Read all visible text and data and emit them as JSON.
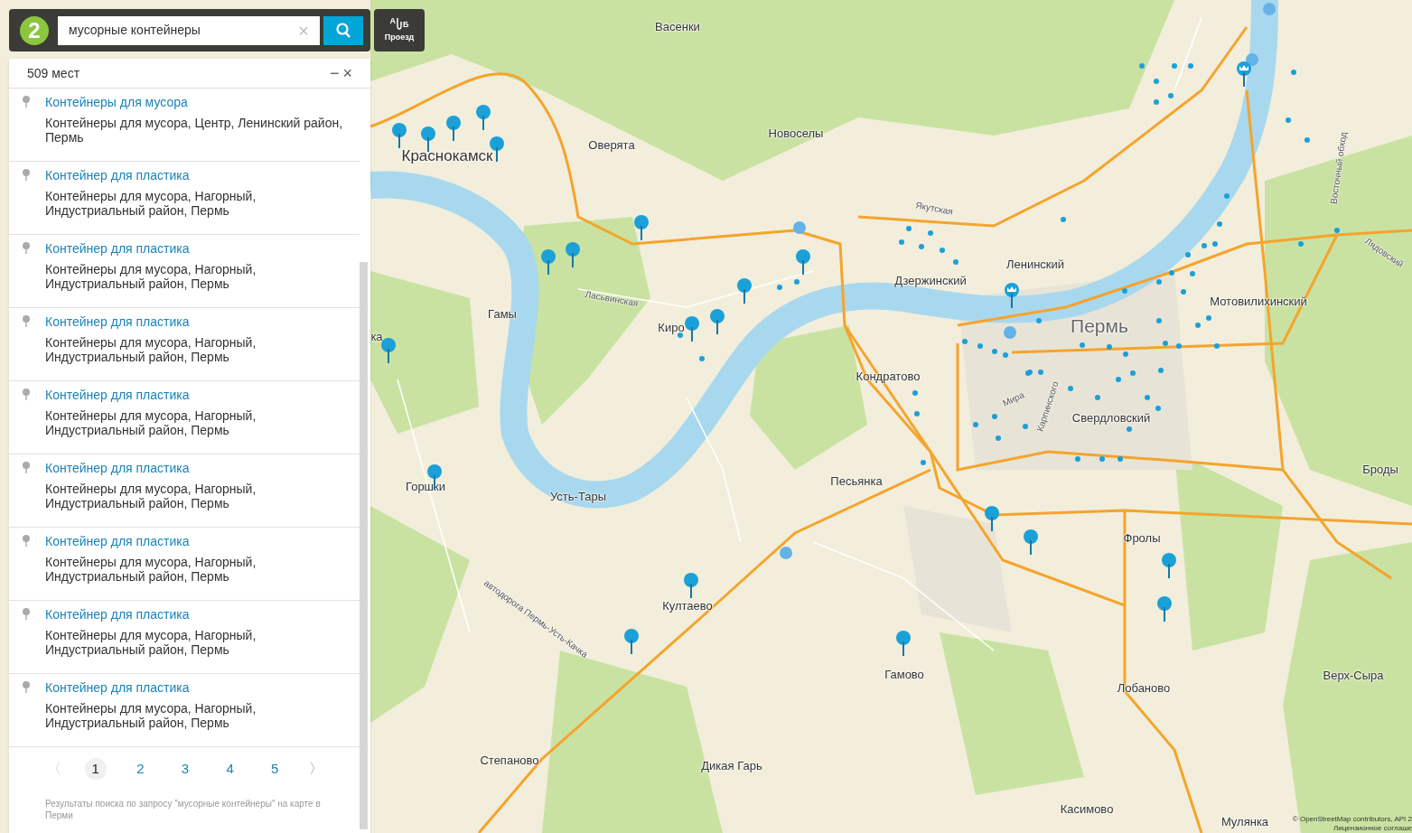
{
  "header": {
    "logo": "2",
    "search": {
      "value": "мусорные контейнеры",
      "clear": "×"
    },
    "route": {
      "from": "А",
      "to": "Б",
      "label": "Проезд"
    }
  },
  "results": {
    "count": "509 мест",
    "minimize": "−",
    "close": "×",
    "items": [
      {
        "title": "Контейнеры для мусора",
        "address": "Контейнеры для мусора, Центр, Ленинский район, Пермь"
      },
      {
        "title": "Контейнер для пластика",
        "address": "Контейнеры для мусора, Нагорный, Индустриальный район, Пермь"
      },
      {
        "title": "Контейнер для пластика",
        "address": "Контейнеры для мусора, Нагорный, Индустриальный район, Пермь"
      },
      {
        "title": "Контейнер для пластика",
        "address": "Контейнеры для мусора, Нагорный, Индустриальный район, Пермь"
      },
      {
        "title": "Контейнер для пластика",
        "address": "Контейнеры для мусора, Нагорный, Индустриальный район, Пермь"
      },
      {
        "title": "Контейнер для пластика",
        "address": "Контейнеры для мусора, Нагорный, Индустриальный район, Пермь"
      },
      {
        "title": "Контейнер для пластика",
        "address": "Контейнеры для мусора, Нагорный, Индустриальный район, Пермь"
      },
      {
        "title": "Контейнер для пластика",
        "address": "Контейнеры для мусора, Нагорный, Индустриальный район, Пермь"
      },
      {
        "title": "Контейнер для пластика",
        "address": "Контейнеры для мусора, Нагорный, Индустриальный район, Пермь"
      }
    ],
    "pagination": {
      "prev": "〈",
      "next": "〉",
      "pages": [
        {
          "label": "1",
          "selected": true
        },
        {
          "label": "2",
          "selected": false
        },
        {
          "label": "3",
          "selected": false
        },
        {
          "label": "4",
          "selected": false
        },
        {
          "label": "5",
          "selected": false
        }
      ]
    },
    "note": "Результаты поиска по запросу \"мусорные контейнеры\" на карте в Перми"
  },
  "map": {
    "labels": [
      {
        "text": "Васенки",
        "kind": "place"
      },
      {
        "text": "Новоселы",
        "kind": "place"
      },
      {
        "text": "Оверята",
        "kind": "place"
      },
      {
        "text": "Краснокамск",
        "kind": "town"
      },
      {
        "text": "Гамы",
        "kind": "place"
      },
      {
        "text": "Якутская",
        "kind": "street"
      },
      {
        "text": "Ленинский",
        "kind": "place"
      },
      {
        "text": "Дзержинский",
        "kind": "place"
      },
      {
        "text": "Пермь",
        "kind": "city"
      },
      {
        "text": "Мотовилихинский",
        "kind": "place"
      },
      {
        "text": "Киро",
        "kind": "place"
      },
      {
        "text": "Ласьвинская",
        "kind": "street"
      },
      {
        "text": "Кондратово",
        "kind": "place"
      },
      {
        "text": "Мира",
        "kind": "street"
      },
      {
        "text": "Карпинского",
        "kind": "street"
      },
      {
        "text": "Свердловский",
        "kind": "place"
      },
      {
        "text": "Песьянка",
        "kind": "place"
      },
      {
        "text": "Усть-Тары",
        "kind": "place"
      },
      {
        "text": "Горшки",
        "kind": "place"
      },
      {
        "text": "Фролы",
        "kind": "place"
      },
      {
        "text": "Броды",
        "kind": "place"
      },
      {
        "text": "Култаево",
        "kind": "place"
      },
      {
        "text": "автодорога Пермь-Усть-Качка",
        "kind": "street"
      },
      {
        "text": "Гамово",
        "kind": "place"
      },
      {
        "text": "Лобаново",
        "kind": "place"
      },
      {
        "text": "Верх-Сыра",
        "kind": "place"
      },
      {
        "text": "Степаново",
        "kind": "place"
      },
      {
        "text": "Дикая Гарь",
        "kind": "place"
      },
      {
        "text": "Касимово",
        "kind": "place"
      },
      {
        "text": "Мулянка",
        "kind": "place"
      },
      {
        "text": "Восточный обход",
        "kind": "street"
      },
      {
        "text": "Лядовский",
        "kind": "street"
      },
      {
        "text": "ка",
        "kind": "place"
      }
    ],
    "attribution": [
      "© OpenStreetMap contributors, API 2",
      "Лицензионное соглаше"
    ]
  }
}
